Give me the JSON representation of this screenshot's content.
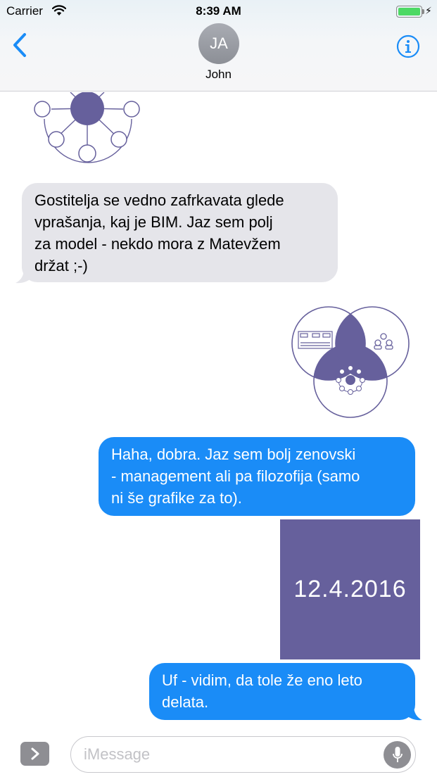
{
  "status_bar": {
    "carrier": "Carrier",
    "time": "8:39 AM",
    "battery_level": 1.0
  },
  "header": {
    "avatar_initials": "JA",
    "contact_name": "John",
    "back_icon": "chevron-left-icon",
    "info_icon": "info-circle-icon"
  },
  "messages": [
    {
      "direction": "in",
      "type": "image",
      "depicts": "hub-and-spoke network diagram"
    },
    {
      "direction": "in",
      "type": "text",
      "lines": [
        "Gostitelja se vedno zafrkavata glede",
        "vprašanja, kaj je BIM. Jaz sem polj",
        "za model - nekdo mora z Matevžem",
        "držat ;-)"
      ]
    },
    {
      "direction": "out",
      "type": "image",
      "depicts": "three-circle venn diagram"
    },
    {
      "direction": "out",
      "type": "text",
      "lines": [
        "Haha, dobra. Jaz sem bolj zenovski",
        "- management ali pa filozofija (samo",
        "ni še grafike za to)."
      ]
    },
    {
      "direction": "out",
      "type": "image",
      "text": "12.4.2016"
    },
    {
      "direction": "out",
      "type": "text",
      "lines": [
        "Uf - vidim, da tole že eno leto",
        "delata."
      ]
    }
  ],
  "input_bar": {
    "placeholder": "iMessage",
    "expand_icon": "chevron-right-icon",
    "mic_icon": "microphone-icon"
  },
  "colors": {
    "accent": "#1a8cf7",
    "incoming_bubble": "#e5e5ea",
    "diagram_purple": "#66609c"
  }
}
